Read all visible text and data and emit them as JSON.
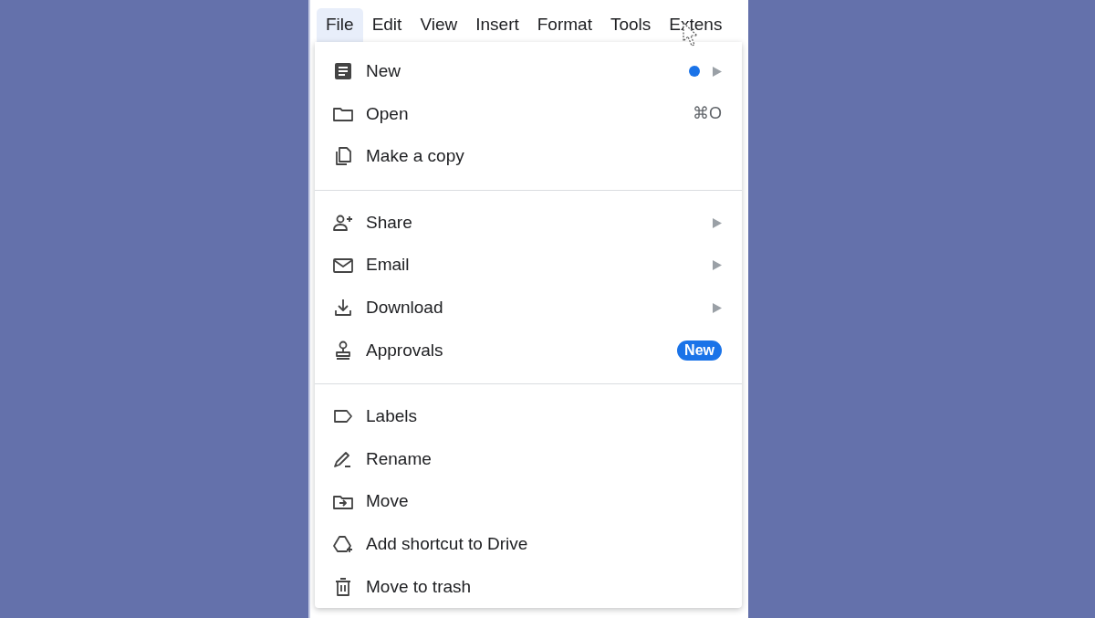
{
  "menubar": [
    {
      "label": "File",
      "selected": true
    },
    {
      "label": "Edit",
      "selected": false
    },
    {
      "label": "View",
      "selected": false
    },
    {
      "label": "Insert",
      "selected": false
    },
    {
      "label": "Format",
      "selected": false
    },
    {
      "label": "Tools",
      "selected": false
    },
    {
      "label": "Extens",
      "selected": false
    }
  ],
  "file_menu": {
    "sections": [
      [
        {
          "label": "New",
          "submenu": true,
          "dot": true
        },
        {
          "label": "Open",
          "submenu": false,
          "dot": false,
          "shortcut": "⌘O"
        },
        {
          "label": "Make a copy",
          "submenu": false,
          "dot": false
        }
      ],
      [
        {
          "label": "Share",
          "submenu": true,
          "dot": false
        },
        {
          "label": "Email",
          "submenu": true,
          "dot": false
        },
        {
          "label": "Download",
          "submenu": true,
          "dot": false
        },
        {
          "label": "Approvals",
          "submenu": false,
          "dot": false,
          "badge": "New"
        }
      ],
      [
        {
          "label": "Labels",
          "submenu": false,
          "dot": false
        },
        {
          "label": "Rename",
          "submenu": false,
          "dot": false
        },
        {
          "label": "Move",
          "submenu": false,
          "dot": false
        },
        {
          "label": "Add shortcut to Drive",
          "submenu": false,
          "dot": false
        },
        {
          "label": "Move to trash",
          "submenu": false,
          "dot": false
        }
      ]
    ]
  }
}
